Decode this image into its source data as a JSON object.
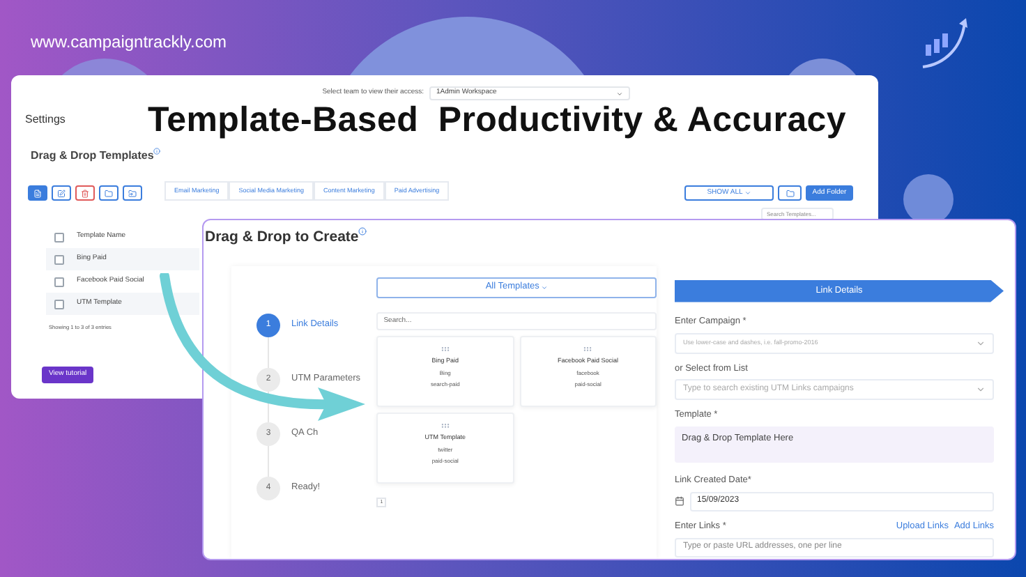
{
  "site_url": "www.campaigntrackly.com",
  "headline": "Template-Based  Productivity & Accuracy",
  "settings_window": {
    "team_label": "Select team to view their access:",
    "team_select": "1Admin Workspace",
    "title": "Settings",
    "section_title": "Drag & Drop Templates",
    "tabs": [
      {
        "label": "Email Marketing",
        "selected": false
      },
      {
        "label": "Social Media Marketing",
        "selected": false
      },
      {
        "label": "Content Marketing",
        "selected": false
      },
      {
        "label": "Paid Advertising",
        "selected": false
      }
    ],
    "show_all": "SHOW ALL",
    "add_folder": "Add Folder",
    "search": {
      "placeholder": "Search Templates..."
    },
    "table": {
      "header": "Template Name",
      "header_checked": false,
      "rows": [
        {
          "name": "Bing Paid",
          "checked": false
        },
        {
          "name": "Facebook Paid Social",
          "checked": false
        },
        {
          "name": "UTM Template",
          "checked": false
        }
      ]
    },
    "footer": "Showing 1 to 3 of 3 entries",
    "tutorial_button": "View tutorial"
  },
  "create_window": {
    "title": "Drag & Drop to Create",
    "steps": [
      {
        "number": "1",
        "label": "Link Details",
        "selected": true
      },
      {
        "number": "2",
        "label": "UTM Parameters",
        "selected": false
      },
      {
        "number": "3",
        "label": "QA Ch",
        "selected": false
      },
      {
        "number": "4",
        "label": "Ready!",
        "selected": false
      }
    ],
    "templates_dropdown": "All Templates",
    "search": {
      "placeholder": "Search..."
    },
    "template_cards": [
      {
        "name": "Bing Paid",
        "source": "Bing",
        "medium": "search-paid"
      },
      {
        "name": "Facebook Paid Social",
        "source": "facebook",
        "medium": "paid-social"
      },
      {
        "name": "UTM Template",
        "source": "twitter",
        "medium": "paid-social"
      }
    ],
    "page": "1",
    "form": {
      "header": "Link Details",
      "fields": [
        {
          "kind": "select",
          "label": "Enter Campaign *",
          "placeholder": "Use lower-case and dashes, i.e. fall-promo-2016"
        },
        {
          "kind": "select",
          "label": "or Select from List",
          "placeholder": "Type to search existing UTM Links campaigns"
        },
        {
          "kind": "dropzone",
          "label": "Template *",
          "value": "Drag & Drop Template Here"
        },
        {
          "kind": "date",
          "label": "Link Created Date*",
          "value": "15/09/2023"
        },
        {
          "kind": "links",
          "label": "Enter Links *",
          "links": [
            "Upload Links",
            "Add Links"
          ],
          "placeholder": "Type or paste URL addresses, one per line"
        }
      ]
    }
  }
}
